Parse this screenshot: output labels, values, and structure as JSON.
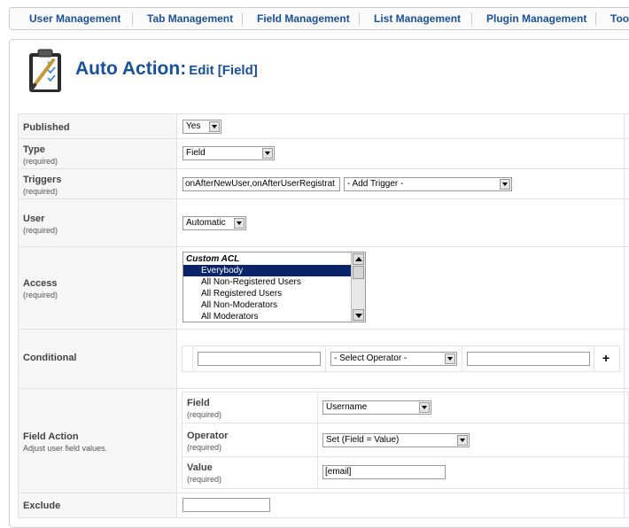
{
  "nav": {
    "items": [
      "User Management",
      "Tab Management",
      "Field Management",
      "List Management",
      "Plugin Management",
      "Too"
    ]
  },
  "header": {
    "title_main": "Auto Action:",
    "title_sub": "Edit [Field]",
    "logo_icon": "clipboard-checklist-icon"
  },
  "form": {
    "published": {
      "label": "Published",
      "value": "Yes"
    },
    "type": {
      "label": "Type",
      "required": "(required)",
      "value": "Field"
    },
    "triggers": {
      "label": "Triggers",
      "required": "(required)",
      "value": "onAfterNewUser,onAfterUserRegistrat",
      "add_trigger": "- Add Trigger -"
    },
    "user": {
      "label": "User",
      "required": "(required)",
      "value": "Automatic"
    },
    "access": {
      "label": "Access",
      "required": "(required)",
      "group": "Custom ACL",
      "options": [
        "Everybody",
        "All Non-Registered Users",
        "All Registered Users",
        "All Non-Moderators",
        "All Moderators"
      ],
      "selected": "Everybody"
    },
    "conditional": {
      "label": "Conditional",
      "field_value": "",
      "operator": "- Select Operator -",
      "value": "",
      "add": "+"
    },
    "field_action": {
      "label": "Field Action",
      "description": "Adjust user field values.",
      "field": {
        "label": "Field",
        "required": "(required)",
        "value": "Username"
      },
      "operator": {
        "label": "Operator",
        "required": "(required)",
        "value": "Set (Field = Value)"
      },
      "value": {
        "label": "Value",
        "required": "(required)",
        "value": "[email]"
      }
    },
    "exclude": {
      "label": "Exclude",
      "value": ""
    }
  },
  "colors": {
    "accent": "#1a5097",
    "selected_bg": "#0a246a"
  }
}
